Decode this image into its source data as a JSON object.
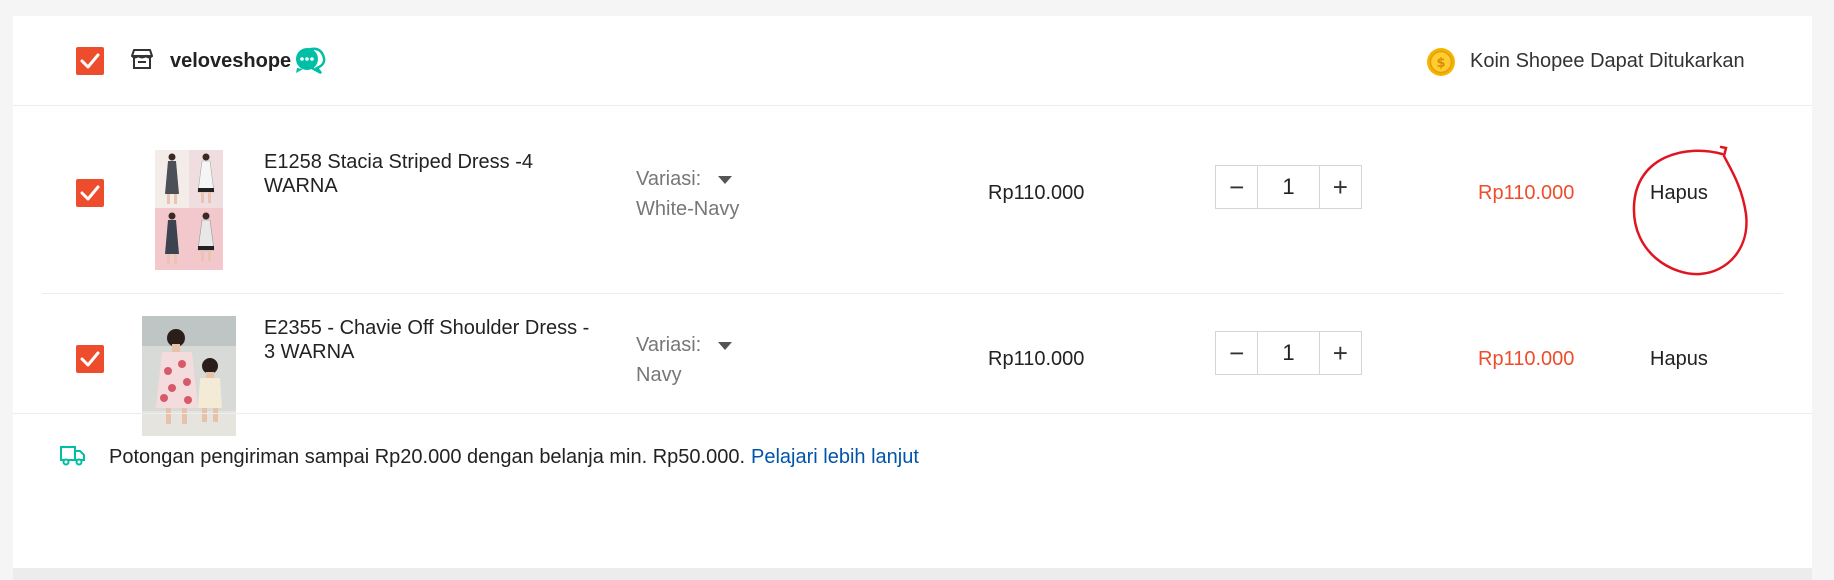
{
  "shop": {
    "name": "veloveshope",
    "coins_label": "Koin Shopee Dapat Ditukarkan",
    "selected": true
  },
  "items": [
    {
      "name": "E1258 Stacia Striped Dress -4 WARNA",
      "variation_label": "Variasi:",
      "variation_value": "White-Navy",
      "price": "Rp110.000",
      "quantity": "1",
      "total": "Rp110.000",
      "delete_label": "Hapus",
      "selected": true
    },
    {
      "name": "E2355 - Chavie Off Shoulder Dress - 3 WARNA",
      "variation_label": "Variasi:",
      "variation_value": "Navy",
      "price": "Rp110.000",
      "quantity": "1",
      "total": "Rp110.000",
      "delete_label": "Hapus",
      "selected": true
    }
  ],
  "qty_controls": {
    "minus": "−",
    "plus": "+"
  },
  "shipping": {
    "text": "Potongan pengiriman sampai Rp20.000 dengan belanja min. Rp50.000.",
    "link": "Pelajari lebih lanjut"
  },
  "colors": {
    "accent": "#ee4d2d",
    "link": "#0055aa",
    "teal": "#00bfa5",
    "annotation": "#e0151f"
  },
  "icons": [
    "store-icon",
    "chat-icon",
    "coin-icon",
    "truck-icon",
    "checkmark-icon"
  ]
}
